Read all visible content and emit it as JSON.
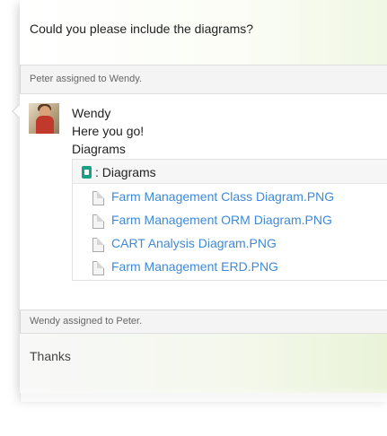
{
  "first_message": {
    "text": "Could you please include the diagrams?"
  },
  "events": [
    {
      "text": "Peter assigned to Wendy."
    },
    {
      "text": "Wendy assigned to Peter."
    }
  ],
  "reply": {
    "author": "Wendy",
    "text": "Here you go!",
    "attachment_label": "Diagrams",
    "folder": {
      "icon": "folder-icon",
      "title": ": Diagrams",
      "files": [
        {
          "name": "Farm Management Class Diagram.PNG",
          "icon": "file-icon"
        },
        {
          "name": "Farm Management ORM Diagram.PNG",
          "icon": "file-icon"
        },
        {
          "name": "CART Analysis Diagram.PNG",
          "icon": "file-icon"
        },
        {
          "name": "Farm Management ERD.PNG",
          "icon": "file-icon"
        }
      ]
    }
  },
  "last_message": {
    "text": "Thanks"
  },
  "colors": {
    "link": "#3d8ad9",
    "folder_icon": "#1aa083"
  }
}
